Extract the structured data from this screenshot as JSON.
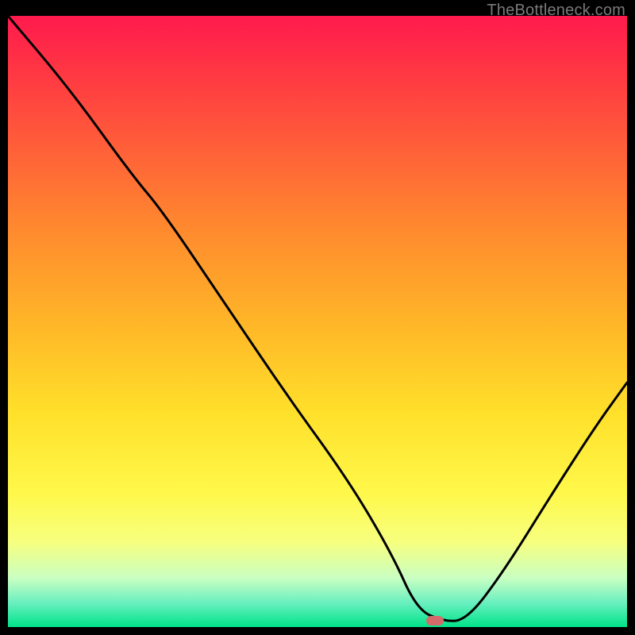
{
  "watermark": "TheBottleneck.com",
  "marker": {
    "x_pct": 69,
    "y_pct": 99
  },
  "chart_data": {
    "type": "line",
    "title": "",
    "xlabel": "",
    "ylabel": "",
    "xlim": [
      0,
      100
    ],
    "ylim": [
      0,
      100
    ],
    "background": "red-yellow-green vertical gradient (mismatch high→low)",
    "series": [
      {
        "name": "bottleneck-curve",
        "x": [
          0,
          10,
          20,
          25,
          35,
          45,
          55,
          62,
          66,
          70,
          74,
          80,
          88,
          95,
          100
        ],
        "values": [
          100,
          88,
          74,
          68,
          53,
          38,
          24,
          12,
          3,
          1,
          1,
          9,
          22,
          33,
          40
        ]
      }
    ],
    "annotations": [
      {
        "type": "marker",
        "x": 69,
        "y": 1,
        "label": "optimal-point",
        "color": "#d46a6a"
      }
    ]
  }
}
